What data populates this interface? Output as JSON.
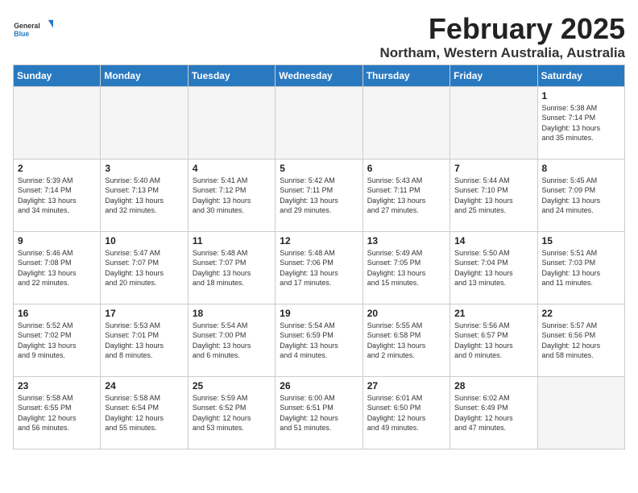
{
  "logo": {
    "general": "General",
    "blue": "Blue"
  },
  "title": "February 2025",
  "subtitle": "Northam, Western Australia, Australia",
  "weekdays": [
    "Sunday",
    "Monday",
    "Tuesday",
    "Wednesday",
    "Thursday",
    "Friday",
    "Saturday"
  ],
  "weeks": [
    [
      {
        "day": "",
        "info": ""
      },
      {
        "day": "",
        "info": ""
      },
      {
        "day": "",
        "info": ""
      },
      {
        "day": "",
        "info": ""
      },
      {
        "day": "",
        "info": ""
      },
      {
        "day": "",
        "info": ""
      },
      {
        "day": "1",
        "info": "Sunrise: 5:38 AM\nSunset: 7:14 PM\nDaylight: 13 hours\nand 35 minutes."
      }
    ],
    [
      {
        "day": "2",
        "info": "Sunrise: 5:39 AM\nSunset: 7:14 PM\nDaylight: 13 hours\nand 34 minutes."
      },
      {
        "day": "3",
        "info": "Sunrise: 5:40 AM\nSunset: 7:13 PM\nDaylight: 13 hours\nand 32 minutes."
      },
      {
        "day": "4",
        "info": "Sunrise: 5:41 AM\nSunset: 7:12 PM\nDaylight: 13 hours\nand 30 minutes."
      },
      {
        "day": "5",
        "info": "Sunrise: 5:42 AM\nSunset: 7:11 PM\nDaylight: 13 hours\nand 29 minutes."
      },
      {
        "day": "6",
        "info": "Sunrise: 5:43 AM\nSunset: 7:11 PM\nDaylight: 13 hours\nand 27 minutes."
      },
      {
        "day": "7",
        "info": "Sunrise: 5:44 AM\nSunset: 7:10 PM\nDaylight: 13 hours\nand 25 minutes."
      },
      {
        "day": "8",
        "info": "Sunrise: 5:45 AM\nSunset: 7:09 PM\nDaylight: 13 hours\nand 24 minutes."
      }
    ],
    [
      {
        "day": "9",
        "info": "Sunrise: 5:46 AM\nSunset: 7:08 PM\nDaylight: 13 hours\nand 22 minutes."
      },
      {
        "day": "10",
        "info": "Sunrise: 5:47 AM\nSunset: 7:07 PM\nDaylight: 13 hours\nand 20 minutes."
      },
      {
        "day": "11",
        "info": "Sunrise: 5:48 AM\nSunset: 7:07 PM\nDaylight: 13 hours\nand 18 minutes."
      },
      {
        "day": "12",
        "info": "Sunrise: 5:48 AM\nSunset: 7:06 PM\nDaylight: 13 hours\nand 17 minutes."
      },
      {
        "day": "13",
        "info": "Sunrise: 5:49 AM\nSunset: 7:05 PM\nDaylight: 13 hours\nand 15 minutes."
      },
      {
        "day": "14",
        "info": "Sunrise: 5:50 AM\nSunset: 7:04 PM\nDaylight: 13 hours\nand 13 minutes."
      },
      {
        "day": "15",
        "info": "Sunrise: 5:51 AM\nSunset: 7:03 PM\nDaylight: 13 hours\nand 11 minutes."
      }
    ],
    [
      {
        "day": "16",
        "info": "Sunrise: 5:52 AM\nSunset: 7:02 PM\nDaylight: 13 hours\nand 9 minutes."
      },
      {
        "day": "17",
        "info": "Sunrise: 5:53 AM\nSunset: 7:01 PM\nDaylight: 13 hours\nand 8 minutes."
      },
      {
        "day": "18",
        "info": "Sunrise: 5:54 AM\nSunset: 7:00 PM\nDaylight: 13 hours\nand 6 minutes."
      },
      {
        "day": "19",
        "info": "Sunrise: 5:54 AM\nSunset: 6:59 PM\nDaylight: 13 hours\nand 4 minutes."
      },
      {
        "day": "20",
        "info": "Sunrise: 5:55 AM\nSunset: 6:58 PM\nDaylight: 13 hours\nand 2 minutes."
      },
      {
        "day": "21",
        "info": "Sunrise: 5:56 AM\nSunset: 6:57 PM\nDaylight: 13 hours\nand 0 minutes."
      },
      {
        "day": "22",
        "info": "Sunrise: 5:57 AM\nSunset: 6:56 PM\nDaylight: 12 hours\nand 58 minutes."
      }
    ],
    [
      {
        "day": "23",
        "info": "Sunrise: 5:58 AM\nSunset: 6:55 PM\nDaylight: 12 hours\nand 56 minutes."
      },
      {
        "day": "24",
        "info": "Sunrise: 5:58 AM\nSunset: 6:54 PM\nDaylight: 12 hours\nand 55 minutes."
      },
      {
        "day": "25",
        "info": "Sunrise: 5:59 AM\nSunset: 6:52 PM\nDaylight: 12 hours\nand 53 minutes."
      },
      {
        "day": "26",
        "info": "Sunrise: 6:00 AM\nSunset: 6:51 PM\nDaylight: 12 hours\nand 51 minutes."
      },
      {
        "day": "27",
        "info": "Sunrise: 6:01 AM\nSunset: 6:50 PM\nDaylight: 12 hours\nand 49 minutes."
      },
      {
        "day": "28",
        "info": "Sunrise: 6:02 AM\nSunset: 6:49 PM\nDaylight: 12 hours\nand 47 minutes."
      },
      {
        "day": "",
        "info": ""
      }
    ]
  ]
}
